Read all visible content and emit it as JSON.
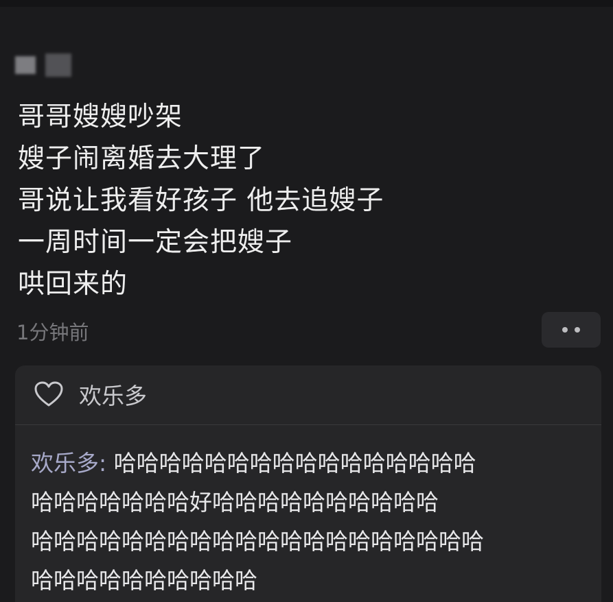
{
  "post": {
    "lines": [
      "哥哥嫂嫂吵架",
      "嫂子闹离婚去大理了",
      "哥说让我看好孩子 他去追嫂子",
      "一周时间一定会把嫂子",
      "哄回来的"
    ],
    "time": "1分钟前"
  },
  "likes": {
    "name": "欢乐多"
  },
  "comment": {
    "author": "欢乐多: ",
    "lines": [
      "哈哈哈哈哈哈哈哈哈哈哈哈哈哈哈哈",
      "哈哈哈哈哈哈哈好哈哈哈哈哈哈哈哈哈哈",
      "哈哈哈哈哈哈哈哈哈哈哈哈哈哈哈哈哈哈哈哈",
      "哈哈哈哈哈哈哈哈哈哈"
    ]
  },
  "icons": {
    "like": "heart-outline-icon",
    "more": "more-dots-icon"
  },
  "colors": {
    "background": "#1b1b1d",
    "card": "#262628",
    "text": "#eeeeee",
    "muted": "#77777b",
    "author": "#a7a9c9"
  }
}
